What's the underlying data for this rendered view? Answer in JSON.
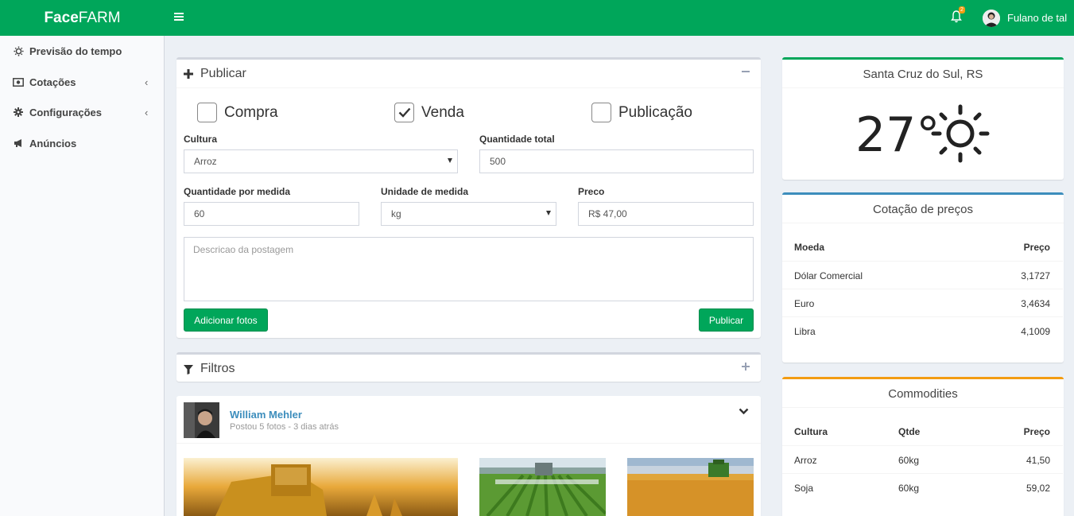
{
  "header": {
    "logo_bold": "Face",
    "logo_rest": "FARM",
    "notification_count": "2",
    "user_name": "Fulano de tal"
  },
  "sidebar": {
    "items": [
      {
        "label": "Previsão do tempo",
        "icon": "sun-icon"
      },
      {
        "label": "Cotações",
        "icon": "money-icon"
      },
      {
        "label": "Configurações",
        "icon": "gear-icon"
      },
      {
        "label": "Anúncios",
        "icon": "megaphone-icon"
      }
    ]
  },
  "publish": {
    "title": "Publicar",
    "options": [
      {
        "label": "Compra",
        "checked": false
      },
      {
        "label": "Venda",
        "checked": true
      },
      {
        "label": "Publicação",
        "checked": false
      }
    ],
    "cultura_label": "Cultura",
    "cultura_value": "Arroz",
    "qtd_total_label": "Quantidade total",
    "qtd_total_value": "500",
    "qtd_medida_label": "Quantidade por medida",
    "qtd_medida_value": "60",
    "unidade_label": "Unidade de medida",
    "unidade_value": "kg",
    "preco_label": "Preco",
    "preco_value": "R$ 47,00",
    "descricao_placeholder": "Descricao da postagem",
    "add_photos": "Adicionar fotos",
    "publish_button": "Publicar"
  },
  "filters": {
    "title": "Filtros"
  },
  "post": {
    "author": "William Mehler",
    "meta": "Postou 5 fotos - 3 dias atrás"
  },
  "weather": {
    "city": "Santa Cruz do Sul, RS",
    "temperature": "27°"
  },
  "quotes": {
    "title": "Cotação de preços",
    "col_currency": "Moeda",
    "col_price": "Preço",
    "rows": [
      {
        "name": "Dólar Comercial",
        "price": "3,1727"
      },
      {
        "name": "Euro",
        "price": "3,4634"
      },
      {
        "name": "Libra",
        "price": "4,1009"
      }
    ]
  },
  "commodities": {
    "title": "Commodities",
    "col_crop": "Cultura",
    "col_qty": "Qtde",
    "col_price": "Preço",
    "rows": [
      {
        "crop": "Arroz",
        "qty": "60kg",
        "price": "41,50"
      },
      {
        "crop": "Soja",
        "qty": "60kg",
        "price": "59,02"
      }
    ]
  },
  "colors": {
    "brand": "#00a65a",
    "quotes_accent": "#3c8dbc",
    "commodities_accent": "#f39c12",
    "author_link": "#3c8dbc"
  }
}
